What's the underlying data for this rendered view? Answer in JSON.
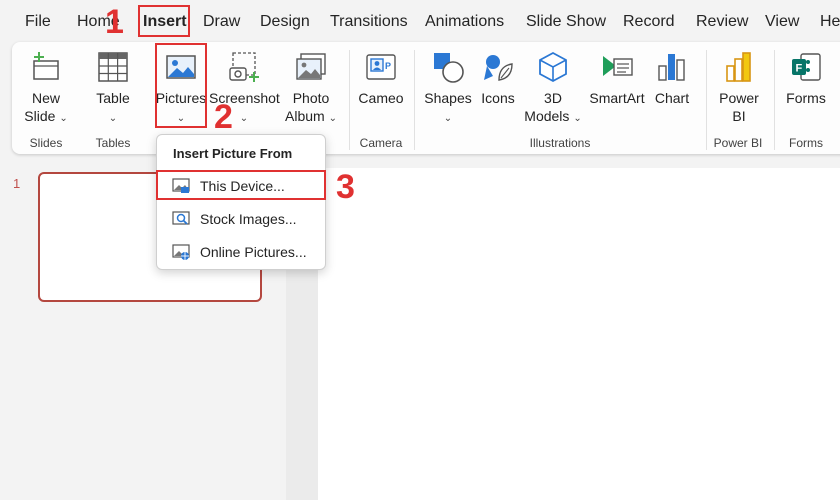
{
  "menu": {
    "tabs": [
      {
        "label": "File"
      },
      {
        "label": "Home"
      },
      {
        "label": "Insert"
      },
      {
        "label": "Draw"
      },
      {
        "label": "Design"
      },
      {
        "label": "Transitions"
      },
      {
        "label": "Animations"
      },
      {
        "label": "Slide Show"
      },
      {
        "label": "Record"
      },
      {
        "label": "Review"
      },
      {
        "label": "View"
      },
      {
        "label": "He"
      }
    ],
    "active_tab": "Insert"
  },
  "ribbon": {
    "buttons": {
      "new_slide": {
        "line1": "New",
        "line2": "Slide",
        "icon": "new-slide-icon"
      },
      "table": {
        "line1": "Table",
        "icon": "table-icon"
      },
      "pictures": {
        "line1": "Pictures",
        "icon": "pictures-icon"
      },
      "screenshot": {
        "line1": "Screenshot",
        "icon": "screenshot-icon"
      },
      "photo_album": {
        "line1": "Photo",
        "line2": "Album",
        "icon": "photo-album-icon"
      },
      "cameo": {
        "line1": "Cameo",
        "icon": "cameo-icon"
      },
      "shapes": {
        "line1": "Shapes",
        "icon": "shapes-icon"
      },
      "icons": {
        "line1": "Icons",
        "icon": "icons-icon"
      },
      "models_3d": {
        "line1": "3D",
        "line2": "Models",
        "icon": "3d-models-icon"
      },
      "smartart": {
        "line1": "SmartArt",
        "icon": "smartart-icon"
      },
      "chart": {
        "line1": "Chart",
        "icon": "chart-icon"
      },
      "power_bi": {
        "line1": "Power",
        "line2": "BI",
        "icon": "power-bi-icon"
      },
      "forms": {
        "line1": "Forms",
        "icon": "forms-icon"
      }
    },
    "groups": {
      "slides": "Slides",
      "tables": "Tables",
      "camera": "Camera",
      "illustrations": "Illustrations",
      "power_bi": "Power BI",
      "forms": "Forms"
    }
  },
  "dropdown": {
    "title": "Insert Picture From",
    "items": [
      {
        "label": "This Device...",
        "icon": "device-picture-icon"
      },
      {
        "label": "Stock Images...",
        "icon": "stock-images-icon"
      },
      {
        "label": "Online Pictures...",
        "icon": "online-pictures-icon"
      }
    ]
  },
  "slides_pane": {
    "slide_number": "1"
  },
  "annotations": {
    "step1": "1",
    "step2": "2",
    "step3": "3",
    "color": "#e03131"
  },
  "colors": {
    "accent": "#b4473f",
    "annotation": "#e03131"
  }
}
